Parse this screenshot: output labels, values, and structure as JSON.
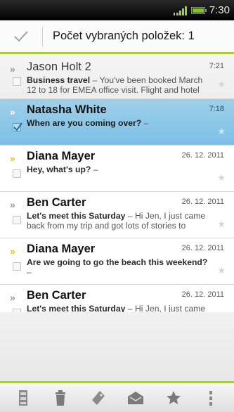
{
  "status_bar": {
    "time": "7:30"
  },
  "header": {
    "title": "Počet vybraných položek: 1"
  },
  "messages": [
    {
      "sender": "Jason Holt",
      "count": "2",
      "date": "7:21",
      "subject": "Business travel",
      "snippet": " – You've been booked March 12 to 18 for EMEA office visit. Flight and hotel",
      "selected": false,
      "flag": "gray"
    },
    {
      "sender": "Natasha White",
      "count": "",
      "date": "7:18",
      "subject": "When are you coming over?",
      "snippet": " –",
      "selected": true,
      "flag": "white"
    },
    {
      "sender": "Diana Mayer",
      "count": "",
      "date": "26. 12. 2011",
      "subject": "Hey, what's up?",
      "snippet": " –",
      "selected": false,
      "flag": "gold"
    },
    {
      "sender": "Ben Carter",
      "count": "",
      "date": "26. 12. 2011",
      "subject": "Let's meet this Saturday",
      "snippet": " – Hi Jen, I just came back from my trip and got lots of stories to",
      "selected": false,
      "flag": "gray"
    },
    {
      "sender": "Diana Mayer",
      "count": "",
      "date": "26. 12. 2011",
      "subject": "Are we going to go the beach this weekend?",
      "snippet": " –",
      "selected": false,
      "flag": "gold"
    },
    {
      "sender": "Ben Carter",
      "count": "",
      "date": "26. 12. 2011",
      "subject": "Let's meet this Saturday",
      "snippet": " – Hi Jen, I just came back from my trip and got lots of stories to",
      "selected": false,
      "flag": "gray"
    }
  ],
  "chevron_glyph": "»",
  "star_glyph": "★",
  "bottom_actions": [
    "move-to-folder-icon",
    "trash-icon",
    "label-icon",
    "mark-read-icon",
    "star-icon",
    "more-icon"
  ],
  "colors": {
    "accent": "#a6cf3b",
    "selected": "#8cc7e8",
    "flag_gold": "#f2c21b"
  }
}
